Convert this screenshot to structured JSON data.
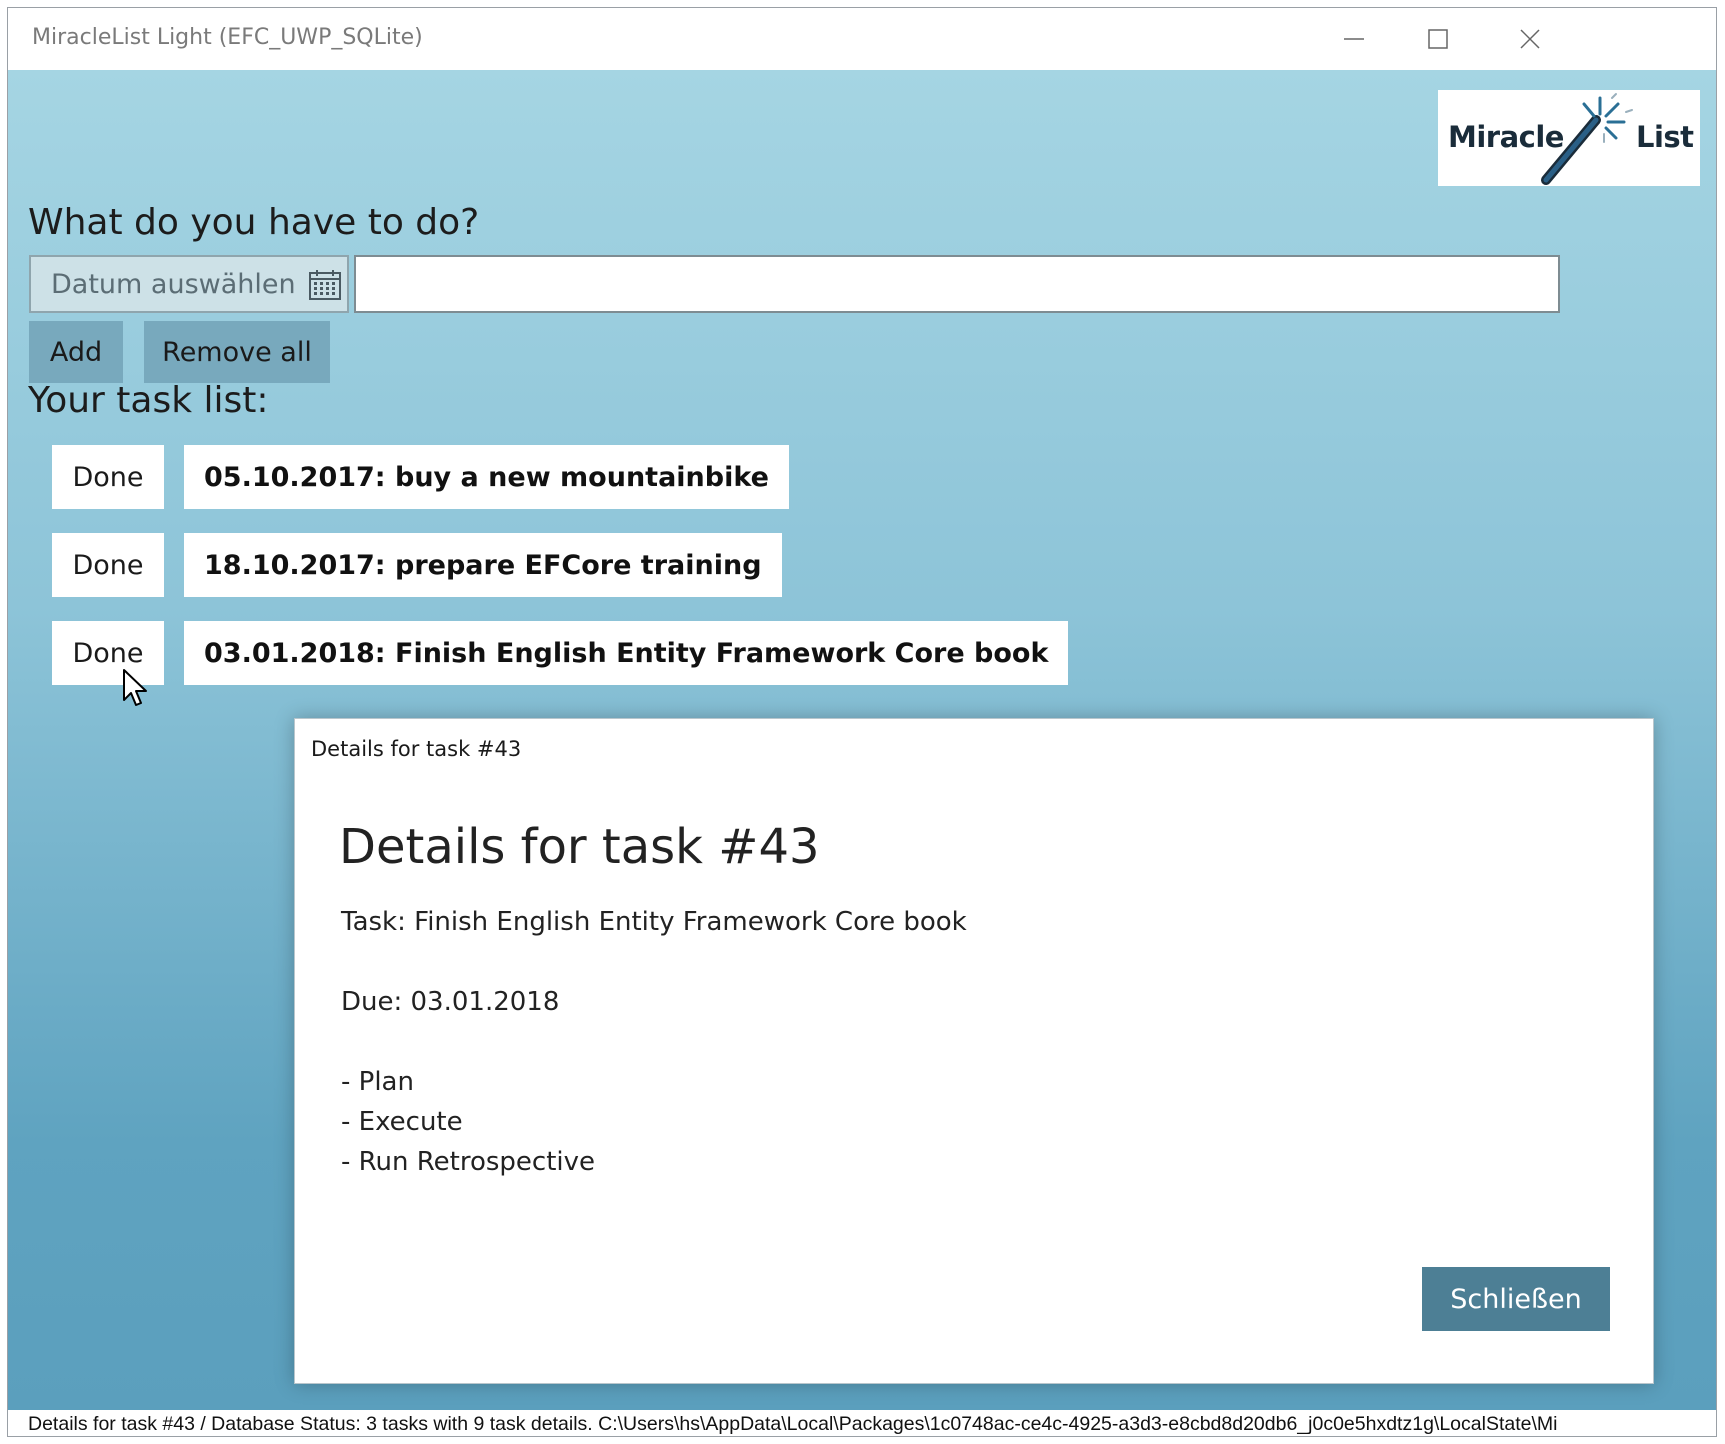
{
  "window": {
    "title": "MiracleList Light (EFC_UWP_SQLite)"
  },
  "logo": {
    "word1": "Miracle",
    "word2": "List"
  },
  "form": {
    "prompt": "What do you have to do?",
    "date_placeholder": "Datum auswählen",
    "task_input_value": "",
    "add_label": "Add",
    "remove_all_label": "Remove all"
  },
  "list": {
    "heading": "Your task list:",
    "tasks": [
      {
        "done_label": "Done",
        "text": "05.10.2017: buy a new mountainbike"
      },
      {
        "done_label": "Done",
        "text": "18.10.2017: prepare EFCore training"
      },
      {
        "done_label": "Done",
        "text": "03.01.2018: Finish English Entity Framework Core book"
      }
    ]
  },
  "dialog": {
    "caption": "Details for task #43",
    "title": "Details for task #43",
    "task_line": "Task: Finish English Entity Framework Core book",
    "due_line": "Due: 03.01.2018",
    "details": [
      "- Plan",
      "- Execute",
      "- Run Retrospective"
    ],
    "close_label": "Schließen"
  },
  "status": {
    "text": "Details for task #43 / Database Status: 3 tasks with 9 task details. C:\\Users\\hs\\AppData\\Local\\Packages\\1c0748ac-ce4c-4925-a3d3-e8cbd8d20db6_j0c0e5hxdtz1g\\LocalState\\Mi"
  },
  "icons": {
    "calendar": "calendar-icon",
    "minimize": "minimize-icon",
    "maximize": "maximize-icon",
    "close": "close-icon",
    "cursor": "mouse-cursor-icon",
    "wand": "magic-wand-icon"
  },
  "colors": {
    "button_gray": "#78a9bd",
    "dialog_button": "#4d7f95",
    "background_top": "#a5d5e3",
    "background_bottom": "#5b9fbd"
  }
}
